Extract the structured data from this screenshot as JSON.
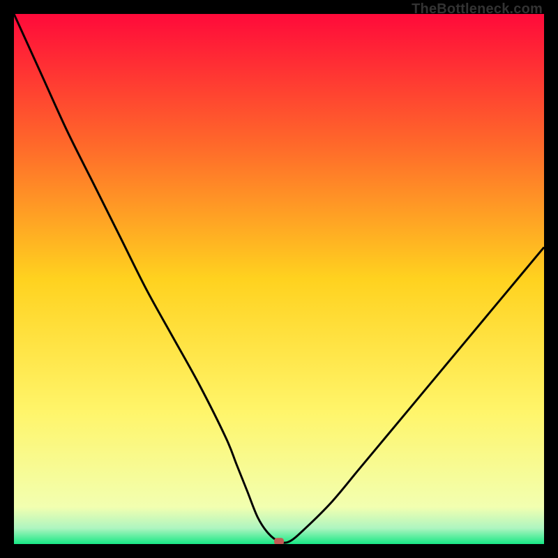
{
  "watermark": "TheBottleneck.com",
  "chart_data": {
    "type": "line",
    "title": "",
    "xlabel": "",
    "ylabel": "",
    "ylim": [
      0,
      100
    ],
    "xlim": [
      0,
      100
    ],
    "x": [
      0,
      5,
      10,
      15,
      20,
      25,
      30,
      35,
      40,
      42,
      44,
      46,
      48,
      50,
      52,
      55,
      60,
      65,
      70,
      75,
      80,
      85,
      90,
      95,
      100
    ],
    "values": [
      100,
      89,
      78,
      68,
      58,
      48,
      39,
      30,
      20,
      15,
      10,
      5,
      2,
      0.5,
      0.5,
      3,
      8,
      14,
      20,
      26,
      32,
      38,
      44,
      50,
      56
    ],
    "marker": {
      "x": 50,
      "y": 0.5,
      "color": "#c45a54"
    },
    "gradient_stops": [
      {
        "offset": 0.0,
        "color": "#ff0a3a"
      },
      {
        "offset": 0.25,
        "color": "#ff6a2a"
      },
      {
        "offset": 0.5,
        "color": "#ffd21f"
      },
      {
        "offset": 0.75,
        "color": "#fff56a"
      },
      {
        "offset": 0.93,
        "color": "#f2ffb0"
      },
      {
        "offset": 0.97,
        "color": "#aef5c0"
      },
      {
        "offset": 1.0,
        "color": "#17e884"
      }
    ],
    "curve_color": "#000000",
    "curve_width": 3
  }
}
